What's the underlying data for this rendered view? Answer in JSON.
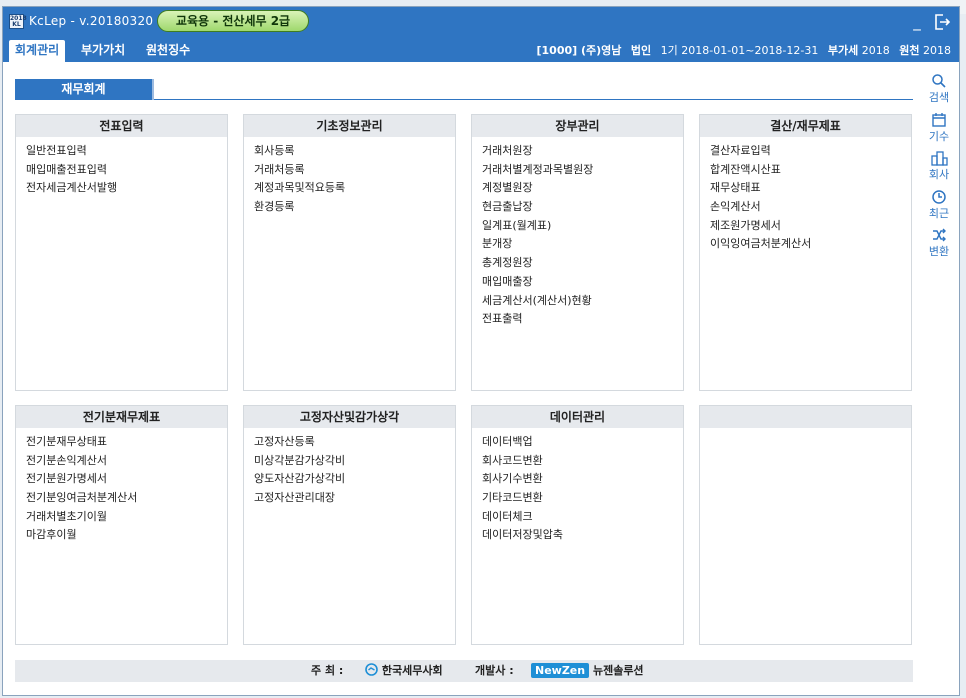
{
  "app": {
    "title": "KcLep - v.20180320",
    "edu_badge": "교육용 - 전산세무 2급",
    "icon_text": "2018 KL"
  },
  "menubar": {
    "tabs": [
      {
        "label": "회계관리",
        "active": true
      },
      {
        "label": "부가가치",
        "active": false
      },
      {
        "label": "원천징수",
        "active": false
      }
    ],
    "company": {
      "code_name": "[1000] (주)영남",
      "type": "법인",
      "period_label": "1기",
      "period": "2018-01-01~2018-12-31",
      "vat_label": "부가세",
      "vat_year": "2018",
      "withholding_label": "원천",
      "withholding_year": "2018"
    }
  },
  "subtab": {
    "label": "재무회계"
  },
  "panels": [
    {
      "title": "전표입력",
      "items": [
        "일반전표입력",
        "매입매출전표입력",
        "전자세금계산서발행"
      ]
    },
    {
      "title": "기초정보관리",
      "items": [
        "회사등록",
        "거래처등록",
        "계정과목및적요등록",
        "환경등록"
      ]
    },
    {
      "title": "장부관리",
      "items": [
        "거래처원장",
        "거래처별계정과목별원장",
        "계정별원장",
        "현금출납장",
        "일계표(월계표)",
        "분개장",
        "총계정원장",
        "매입매출장",
        "세금계산서(계산서)현황",
        "전표출력"
      ]
    },
    {
      "title": "결산/재무제표",
      "items": [
        "결산자료입력",
        "합계잔액시산표",
        "재무상태표",
        "손익계산서",
        "제조원가명세서",
        "이익잉여금처분계산서"
      ]
    },
    {
      "title": "전기분재무제표",
      "items": [
        "전기분재무상태표",
        "전기분손익계산서",
        "전기분원가명세서",
        "전기분잉여금처분계산서",
        "거래처별초기이월",
        "마감후이월"
      ]
    },
    {
      "title": "고정자산및감가상각",
      "items": [
        "고정자산등록",
        "미상각분감가상각비",
        "양도자산감가상각비",
        "고정자산관리대장"
      ]
    },
    {
      "title": "데이터관리",
      "items": [
        "데이터백업",
        "회사코드변환",
        "회사기수변환",
        "기타코드변환",
        "데이터체크",
        "데이터저장및압축"
      ]
    },
    {
      "title": "",
      "items": []
    }
  ],
  "sidetools": [
    {
      "label": "검색",
      "icon": "search-icon"
    },
    {
      "label": "기수",
      "icon": "calendar-icon"
    },
    {
      "label": "회사",
      "icon": "building-icon"
    },
    {
      "label": "최근",
      "icon": "clock-icon"
    },
    {
      "label": "변환",
      "icon": "shuffle-icon"
    }
  ],
  "footer": {
    "host_label": "주  최  :",
    "host_org": "한국세무사회",
    "dev_label": "개발사  :",
    "dev_brand": "NewZen",
    "dev_name": "뉴젠솔루션"
  },
  "colors": {
    "accent": "#2f75c2",
    "badge": "#9fd86d",
    "panel_header": "#e6e9ed"
  }
}
